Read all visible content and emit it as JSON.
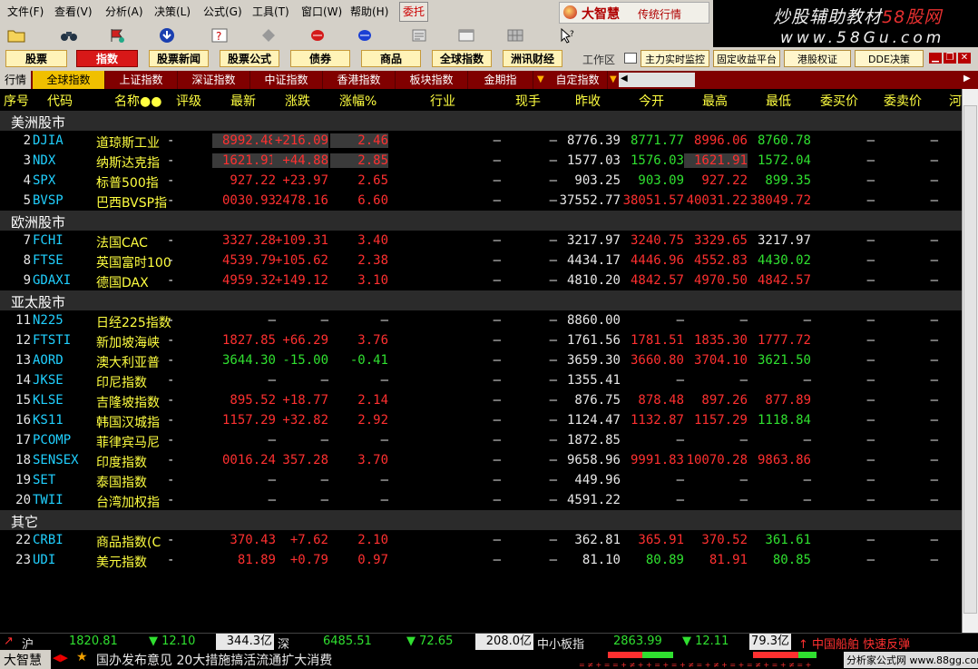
{
  "menu": {
    "items": [
      "文件(F)",
      "查看(V)",
      "分析(A)",
      "决策(L)",
      "公式(G)",
      "工具(T)",
      "窗口(W)",
      "帮助(H)"
    ],
    "weituo": "委托",
    "brand_name": "大智慧",
    "brand_sub": "传统行情"
  },
  "watermark": {
    "line1_a": "炒股辅助教材",
    "line1_b": "58股网",
    "line2": "www.58Gu.com"
  },
  "buttons": {
    "main": [
      "股票",
      "指数",
      "股票新闻",
      "股票公式",
      "债券",
      "商品",
      "全球指数",
      "洲讯财经"
    ],
    "active": "指数",
    "work_area": "工作区",
    "right": [
      "主力实时监控",
      "固定收益平台",
      "港股权证",
      "DDE决策"
    ]
  },
  "tabs": {
    "label": "行情",
    "items": [
      "全球指数",
      "上证指数",
      "深证指数",
      "中证指数",
      "香港指数",
      "板块指数",
      "金期指",
      "自定指数"
    ],
    "selected": "全球指数"
  },
  "headers": [
    "序号",
    "代码",
    "名称●●",
    "评级",
    "最新",
    "涨跌",
    "涨幅%",
    "行业",
    "现手",
    "昨收",
    "今开",
    "最高",
    "最低",
    "委买价",
    "委卖价",
    "河"
  ],
  "sections": [
    {
      "title": "美洲股市",
      "rows": [
        {
          "no": "2",
          "code": "DJIA",
          "name": "道琼斯工业",
          "rate": "-",
          "last": "8992.48",
          "chg": "+216.09",
          "pct": "2.46",
          "ind": "—",
          "vol": "—",
          "prev": "8776.39",
          "open": "8771.77",
          "high": "8996.06",
          "low": "8760.78",
          "bid": "—",
          "ask": "—",
          "c": "R",
          "oc": "G",
          "hc": "R",
          "lc": "G",
          "hl": true
        },
        {
          "no": "3",
          "code": "NDX",
          "name": "纳斯达克指",
          "rate": "-",
          "last": "1621.91",
          "chg": "+44.88",
          "pct": "2.85",
          "ind": "—",
          "vol": "—",
          "prev": "1577.03",
          "open": "1576.03",
          "high": "1621.91",
          "low": "1572.04",
          "bid": "—",
          "ask": "—",
          "c": "R",
          "oc": "G",
          "hc": "R",
          "lc": "G",
          "hl": true,
          "hlHigh": true
        },
        {
          "no": "4",
          "code": "SPX",
          "name": "标普500指",
          "rate": "-",
          "last": "927.22",
          "chg": "+23.97",
          "pct": "2.65",
          "ind": "—",
          "vol": "—",
          "prev": "903.25",
          "open": "903.09",
          "high": "927.22",
          "low": "899.35",
          "bid": "—",
          "ask": "—",
          "c": "R",
          "oc": "G",
          "hc": "R",
          "lc": "G"
        },
        {
          "no": "5",
          "code": "BVSP",
          "name": "巴西BVSP指",
          "rate": "-",
          "last": "0030.93",
          "chg": "2478.16",
          "pct": "6.60",
          "ind": "—",
          "vol": "—",
          "prev": "37552.77",
          "open": "38051.57",
          "high": "40031.22",
          "low": "38049.72",
          "bid": "—",
          "ask": "—",
          "c": "R",
          "oc": "R",
          "hc": "R",
          "lc": "R"
        }
      ]
    },
    {
      "title": "欧洲股市",
      "rows": [
        {
          "no": "7",
          "code": "FCHI",
          "name": "法国CAC",
          "rate": "-",
          "last": "3327.28",
          "chg": "+109.31",
          "pct": "3.40",
          "ind": "—",
          "vol": "—",
          "prev": "3217.97",
          "open": "3240.75",
          "high": "3329.65",
          "low": "3217.97",
          "bid": "—",
          "ask": "—",
          "c": "R",
          "oc": "R",
          "hc": "R",
          "lc": "W"
        },
        {
          "no": "8",
          "code": "FTSE",
          "name": "英国富时100",
          "rate": "-",
          "last": "4539.79",
          "chg": "+105.62",
          "pct": "2.38",
          "ind": "—",
          "vol": "—",
          "prev": "4434.17",
          "open": "4446.96",
          "high": "4552.83",
          "low": "4430.02",
          "bid": "—",
          "ask": "—",
          "c": "R",
          "oc": "R",
          "hc": "R",
          "lc": "G"
        },
        {
          "no": "9",
          "code": "GDAXI",
          "name": "德国DAX",
          "rate": "-",
          "last": "4959.32",
          "chg": "+149.12",
          "pct": "3.10",
          "ind": "—",
          "vol": "—",
          "prev": "4810.20",
          "open": "4842.57",
          "high": "4970.50",
          "low": "4842.57",
          "bid": "—",
          "ask": "—",
          "c": "R",
          "oc": "R",
          "hc": "R",
          "lc": "R"
        }
      ]
    },
    {
      "title": "亚太股市",
      "rows": [
        {
          "no": "11",
          "code": "N225",
          "name": "日经225指数",
          "rate": "-",
          "last": "—",
          "chg": "—",
          "pct": "—",
          "ind": "—",
          "vol": "—",
          "prev": "8860.00",
          "open": "—",
          "high": "—",
          "low": "—",
          "bid": "—",
          "ask": "—",
          "c": "W",
          "oc": "W",
          "hc": "W",
          "lc": "W"
        },
        {
          "no": "12",
          "code": "FTSTI",
          "name": "新加坡海峡",
          "rate": "-",
          "last": "1827.85",
          "chg": "+66.29",
          "pct": "3.76",
          "ind": "—",
          "vol": "—",
          "prev": "1761.56",
          "open": "1781.51",
          "high": "1835.30",
          "low": "1777.72",
          "bid": "—",
          "ask": "—",
          "c": "R",
          "oc": "R",
          "hc": "R",
          "lc": "R"
        },
        {
          "no": "13",
          "code": "AORD",
          "name": "澳大利亚普",
          "rate": "-",
          "last": "3644.30",
          "chg": "-15.00",
          "pct": "-0.41",
          "ind": "—",
          "vol": "—",
          "prev": "3659.30",
          "open": "3660.80",
          "high": "3704.10",
          "low": "3621.50",
          "bid": "—",
          "ask": "—",
          "c": "G",
          "oc": "R",
          "hc": "R",
          "lc": "G"
        },
        {
          "no": "14",
          "code": "JKSE",
          "name": "印尼指数",
          "rate": "-",
          "last": "—",
          "chg": "—",
          "pct": "—",
          "ind": "—",
          "vol": "—",
          "prev": "1355.41",
          "open": "—",
          "high": "—",
          "low": "—",
          "bid": "—",
          "ask": "—",
          "c": "W",
          "oc": "W",
          "hc": "W",
          "lc": "W"
        },
        {
          "no": "15",
          "code": "KLSE",
          "name": "吉隆坡指数",
          "rate": "-",
          "last": "895.52",
          "chg": "+18.77",
          "pct": "2.14",
          "ind": "—",
          "vol": "—",
          "prev": "876.75",
          "open": "878.48",
          "high": "897.26",
          "low": "877.89",
          "bid": "—",
          "ask": "—",
          "c": "R",
          "oc": "R",
          "hc": "R",
          "lc": "R"
        },
        {
          "no": "16",
          "code": "KS11",
          "name": "韩国汉城指",
          "rate": "-",
          "last": "1157.29",
          "chg": "+32.82",
          "pct": "2.92",
          "ind": "—",
          "vol": "—",
          "prev": "1124.47",
          "open": "1132.87",
          "high": "1157.29",
          "low": "1118.84",
          "bid": "—",
          "ask": "—",
          "c": "R",
          "oc": "R",
          "hc": "R",
          "lc": "G"
        },
        {
          "no": "17",
          "code": "PCOMP",
          "name": "菲律宾马尼",
          "rate": "-",
          "last": "—",
          "chg": "—",
          "pct": "—",
          "ind": "—",
          "vol": "—",
          "prev": "1872.85",
          "open": "—",
          "high": "—",
          "low": "—",
          "bid": "—",
          "ask": "—",
          "c": "W",
          "oc": "W",
          "hc": "W",
          "lc": "W"
        },
        {
          "no": "18",
          "code": "SENSEX",
          "name": "印度指数",
          "rate": "-",
          "last": "0016.24",
          "chg": "357.28",
          "pct": "3.70",
          "ind": "—",
          "vol": "—",
          "prev": "9658.96",
          "open": "9991.83",
          "high": "10070.28",
          "low": "9863.86",
          "bid": "—",
          "ask": "—",
          "c": "R",
          "oc": "R",
          "hc": "R",
          "lc": "R"
        },
        {
          "no": "19",
          "code": "SET",
          "name": "泰国指数",
          "rate": "-",
          "last": "—",
          "chg": "—",
          "pct": "—",
          "ind": "—",
          "vol": "—",
          "prev": "449.96",
          "open": "—",
          "high": "—",
          "low": "—",
          "bid": "—",
          "ask": "—",
          "c": "W",
          "oc": "W",
          "hc": "W",
          "lc": "W"
        },
        {
          "no": "20",
          "code": "TWII",
          "name": "台湾加权指",
          "rate": "-",
          "last": "—",
          "chg": "—",
          "pct": "—",
          "ind": "—",
          "vol": "—",
          "prev": "4591.22",
          "open": "—",
          "high": "—",
          "low": "—",
          "bid": "—",
          "ask": "—",
          "c": "W",
          "oc": "W",
          "hc": "W",
          "lc": "W"
        }
      ]
    },
    {
      "title": "其它",
      "rows": [
        {
          "no": "22",
          "code": "CRBI",
          "name": "商品指数(C",
          "rate": "-",
          "last": "370.43",
          "chg": "+7.62",
          "pct": "2.10",
          "ind": "—",
          "vol": "—",
          "prev": "362.81",
          "open": "365.91",
          "high": "370.52",
          "low": "361.61",
          "bid": "—",
          "ask": "—",
          "c": "R",
          "oc": "R",
          "hc": "R",
          "lc": "G"
        },
        {
          "no": "23",
          "code": "UDI",
          "name": "美元指数",
          "rate": "-",
          "last": "81.89",
          "chg": "+0.79",
          "pct": "0.97",
          "ind": "—",
          "vol": "—",
          "prev": "81.10",
          "open": "80.89",
          "high": "81.91",
          "low": "80.85",
          "bid": "—",
          "ask": "—",
          "c": "R",
          "oc": "G",
          "hc": "R",
          "lc": "G"
        }
      ]
    }
  ],
  "status": {
    "sh_label": "沪",
    "sh_value": "1820.81",
    "sh_chg": "▼ 12.10",
    "sh_amt": "344.3亿",
    "sz_label": "深",
    "sz_value": "6485.51",
    "sz_chg": "▼ 72.65",
    "sz_amt": "208.0亿",
    "zx_label": "中小板指",
    "zx_value": "2863.99",
    "zx_chg": "▼ 12.11",
    "zx_amt": "79.3亿",
    "alert": "↑ 中国船舶 快速反弹"
  },
  "ticker": {
    "brand": "大智慧",
    "text": "国办发布意见 20大措施搞活流通扩大消费",
    "site": "分析家公式网 www.88gg.com"
  },
  "colors": {
    "up": "#ff3030",
    "down": "#30e030",
    "flat": "#e8e8e8",
    "header": "#ffff40",
    "code": "#20d0ff"
  }
}
